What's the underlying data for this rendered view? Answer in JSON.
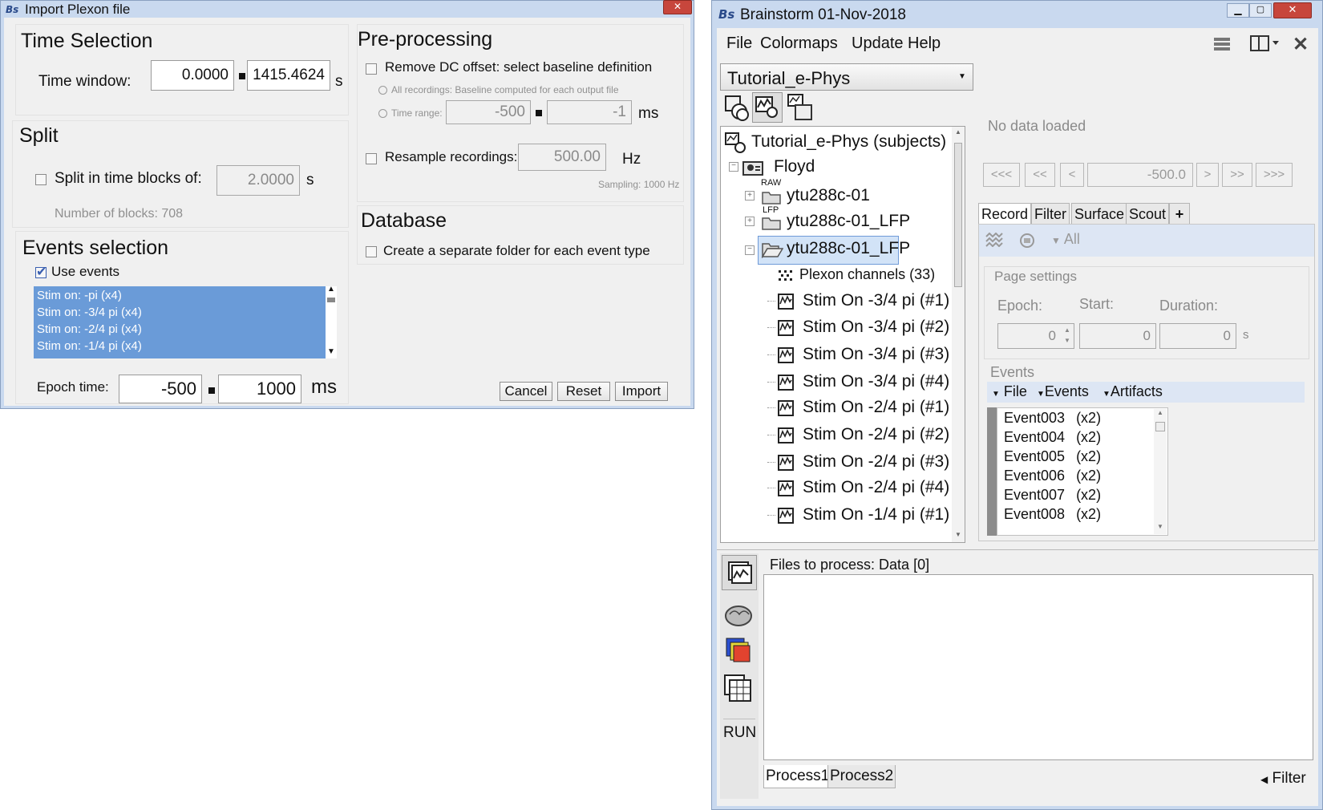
{
  "import_dialog": {
    "title": "Import Plexon file",
    "time_selection": {
      "title": "Time Selection",
      "time_window_label": "Time window:",
      "start": "0.0000",
      "end": "1415.4624",
      "unit": "s"
    },
    "split": {
      "title": "Split",
      "checkbox_label": "Split in time blocks of:",
      "value": "2.0000",
      "unit": "s",
      "blocks_info": "Number of blocks: 708"
    },
    "events_selection": {
      "title": "Events selection",
      "use_events_label": "Use events",
      "events": [
        "Stim on: -pi (x4)",
        "Stim on: -3/4 pi (x4)",
        "Stim on: -2/4 pi (x4)",
        "Stim on: -1/4 pi (x4)"
      ],
      "epoch_time_label": "Epoch time:",
      "epoch_start": "-500",
      "epoch_end": "1000",
      "epoch_unit": "ms"
    },
    "preprocessing": {
      "title": "Pre-processing",
      "remove_dc_label": "Remove DC offset: select baseline definition",
      "all_recordings_label": "All recordings: Baseline computed for each output file",
      "time_range_label": "Time range:",
      "time_range_start": "-500",
      "time_range_end": "-1",
      "time_range_unit": "ms",
      "resample_label": "Resample recordings:",
      "resample_value": "500.00",
      "resample_unit": "Hz",
      "sampling_info": "Sampling: 1000 Hz"
    },
    "database": {
      "title": "Database",
      "separate_folder_label": "Create a separate folder for each event type"
    },
    "buttons": {
      "cancel": "Cancel",
      "reset": "Reset",
      "import": "Import"
    }
  },
  "brainstorm": {
    "title": "Brainstorm 01-Nov-2018",
    "menu": [
      "File",
      "Colormaps",
      "Update",
      "Help"
    ],
    "protocol": "Tutorial_e-Phys",
    "tree": {
      "root": "Tutorial_e-Phys (subjects)",
      "subject": "Floyd",
      "folders": [
        {
          "tag": "RAW",
          "label": "ytu288c-01"
        },
        {
          "tag": "LFP",
          "label": "ytu288c-01_LFP"
        },
        {
          "tag": "",
          "label": "ytu288c-01_LFP"
        }
      ],
      "channels": "Plexon channels (33)",
      "items": [
        "Stim On -3/4 pi (#1)",
        "Stim On -3/4 pi (#2)",
        "Stim On -3/4 pi (#3)",
        "Stim On -3/4 pi (#4)",
        "Stim On -2/4 pi (#1)",
        "Stim On -2/4 pi (#2)",
        "Stim On -2/4 pi (#3)",
        "Stim On -2/4 pi (#4)",
        "Stim On -1/4 pi (#1)"
      ]
    },
    "record": {
      "no_data": "No data loaded",
      "nav_buttons": [
        "<<<",
        "<<",
        "<",
        ">",
        ">>",
        ">>>"
      ],
      "time_value": "-500.0",
      "tabs": [
        "Record",
        "Filter",
        "Surface",
        "Scout",
        "+"
      ],
      "toolbar_all": "All",
      "page_settings": {
        "title": "Page settings",
        "epoch_label": "Epoch:",
        "start_label": "Start:",
        "duration_label": "Duration:",
        "epoch": "0",
        "start": "0",
        "duration": "0",
        "unit": "s"
      },
      "events": {
        "title": "Events",
        "menus": [
          "File",
          "Events",
          "Artifacts"
        ],
        "list": [
          {
            "name": "Event003",
            "count": "(x2)"
          },
          {
            "name": "Event004",
            "count": "(x2)"
          },
          {
            "name": "Event005",
            "count": "(x2)"
          },
          {
            "name": "Event006",
            "count": "(x2)"
          },
          {
            "name": "Event007",
            "count": "(x2)"
          },
          {
            "name": "Event008",
            "count": "(x2)"
          }
        ]
      }
    },
    "process": {
      "files_label": "Files to process: Data [0]",
      "run_label": "RUN",
      "tabs": [
        "Process1",
        "Process2"
      ],
      "filter_label": "Filter"
    }
  }
}
